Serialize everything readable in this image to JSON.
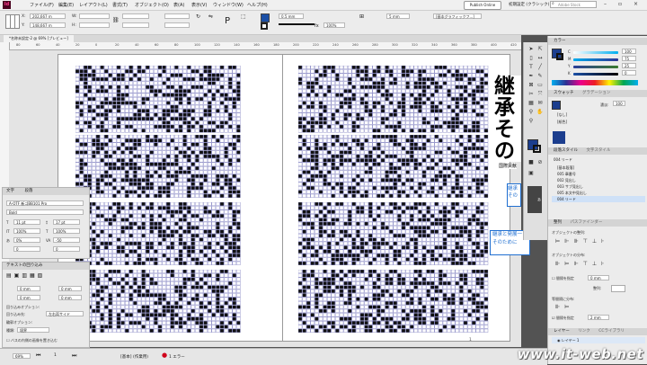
{
  "app": {
    "logo": "Id"
  },
  "menu": [
    "ファイル(F)",
    "編集(E)",
    "レイアウト(L)",
    "書式(T)",
    "オブジェクト(O)",
    "表(A)",
    "表示(V)",
    "ウィンドウ(W)",
    "ヘルプ(H)"
  ],
  "top_right": {
    "publish_label": "Publish Online",
    "workspace_label": "初期設定 (クラシック)",
    "search_placeholder": "Adobe Stock"
  },
  "control": {
    "x_label": "X:",
    "x_value": "202,667 m",
    "y_label": "Y:",
    "y_value": "148,667 m",
    "w_label": "W:",
    "h_label": "H:",
    "stroke_weight": "0.5 mm",
    "opacity": "100%",
    "dimension": "5 mm",
    "object_style": "[基本グラフィックフ...]"
  },
  "doc_tab": "*名称未設定-2 @ 69% [プレビュー]",
  "ruler_ticks": [
    "80",
    "60",
    "40",
    "20",
    "0",
    "20",
    "40",
    "60",
    "80",
    "100",
    "120",
    "140",
    "160",
    "180",
    "200",
    "220",
    "240",
    "260",
    "280",
    "300",
    "320",
    "340",
    "360",
    "380",
    "400",
    "420"
  ],
  "page_text": {
    "big_line1": "継承",
    "big_line2": "その",
    "small_a": "国際貢献",
    "small_b1": "継承",
    "small_b2": "その",
    "blue_line1": "継承と発展一",
    "blue_line2": "そのために"
  },
  "char_panel": {
    "tabs": [
      "文字",
      "段落"
    ],
    "font_family": "A-OTF 新ゴBB101 Pro",
    "font_style": "Bold",
    "size": "11 pt",
    "leading": "17 pt",
    "vscale": "100%",
    "hscale": "100%",
    "tsume": "0%",
    "tracking": "-50",
    "kerning": "0",
    "baseline": "0"
  },
  "wrap_panel": {
    "title": "テキストの回り込み",
    "top": "0 mm",
    "bottom": "0 mm",
    "left": "0 mm",
    "right": "0 mm",
    "options_label": "回り込みオプション:",
    "target_label": "回り込み先:",
    "target_value": "左右両サイド",
    "contour_label": "輪郭オプション:",
    "type_label": "種類:",
    "type_value": "境界",
    "checkbox_label": "バスの内側の画像を置き込む"
  },
  "color_panel": {
    "title": "カラー",
    "c": "100",
    "m": "75",
    "y": "25",
    "k": "0",
    "c_label": "C",
    "m_label": "M",
    "y_label": "Y",
    "k_label": "K"
  },
  "swatches_panel": {
    "tabs": [
      "スウォッチ",
      "グラデーション"
    ],
    "tint_label": "濃淡:",
    "tint_value": "100",
    "items": [
      "[なし]",
      "[紙色]"
    ]
  },
  "styles_panel": {
    "tabs": [
      "段落スタイル",
      "文字スタイル"
    ],
    "current": "004 リード",
    "items": [
      "[基本段落]",
      "005 章番号",
      "002 見出し",
      "003 サブ見出し",
      "005 本文中見出し",
      "004 リード"
    ]
  },
  "align_panel": {
    "tabs": [
      "整列",
      "パスファインダー"
    ],
    "align_objects": "オブジェクトの整列:",
    "distribute_objects": "オブジェクトの分布:",
    "use_spacing": "間隔を指定",
    "spacing_value": "0 mm",
    "align_to_label": "整列:",
    "distribute_spacing": "等間隔に分布:",
    "use_spacing2": "間隔を指定",
    "spacing_value2": "2 mm"
  },
  "layers_panel": {
    "tabs": [
      "レイヤー",
      "リンク",
      "CCライブラリ"
    ],
    "layer": "レイヤー 1"
  },
  "status": {
    "zoom": "69%",
    "profile": "[基本] (作業用)",
    "errors": "1 エラー",
    "page_num": "1"
  },
  "watermark": "www.it-web.net",
  "colors": {
    "accent_blue": "#1b4fa6",
    "blue_text": "#1f6fd1",
    "swatch_fill": "#1c3e8e"
  }
}
